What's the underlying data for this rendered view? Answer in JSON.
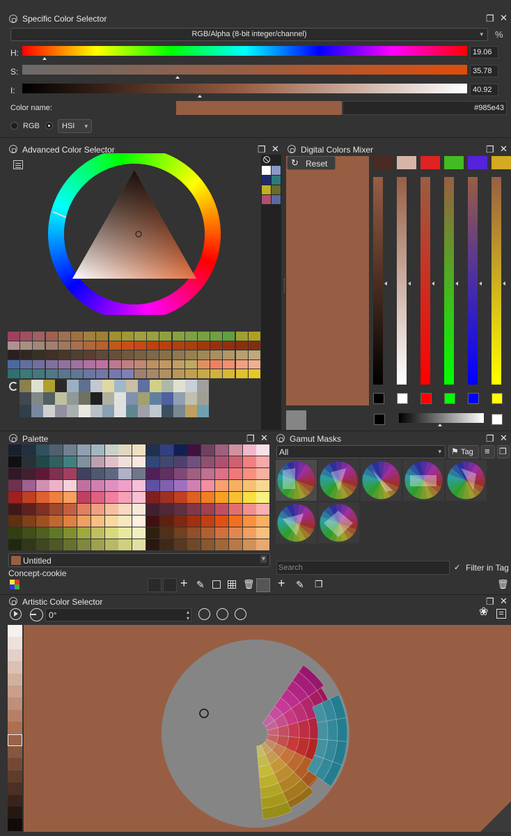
{
  "colors": {
    "current": "#985e43",
    "bg": "#333333",
    "panel": "#2b2b2b",
    "accent": "#985e43"
  },
  "specific": {
    "title": "Specific Color Selector",
    "model": "RGB/Alpha (8-bit integer/channel)",
    "percent_label": "%",
    "h_label": "H:",
    "h_value": "19.06",
    "s_label": "S:",
    "s_value": "35.78",
    "i_label": "I:",
    "i_value": "40.92",
    "h_frac": 0.0529,
    "s_frac": 0.3578,
    "i_frac": 0.4092,
    "color_name_label": "Color name:",
    "hex_value": "#985e43",
    "rgb_label": "RGB",
    "hsi_label": "HSI"
  },
  "advanced": {
    "title": "Advanced Color Selector"
  },
  "mixer": {
    "title": "Digital Colors Mixer",
    "reset_label": "Reset",
    "swatch_colors": [
      "#4a2a22",
      "#d8b4a8",
      "#e02222",
      "#44bb22",
      "#5522dd",
      "#d4aa22"
    ],
    "channel_colors": [
      "#ffffff",
      "#ff0000",
      "#00ff00",
      "#0000ff",
      "#ffff00"
    ]
  },
  "palette": {
    "title": "Palette",
    "name": "Untitled",
    "subname": "Concept-cookie"
  },
  "gamut": {
    "title": "Gamut Masks",
    "filter": "All",
    "tag_label": "Tag",
    "search_placeholder": "Search",
    "filter_in_tag": "Filter in Tag"
  },
  "artistic": {
    "title": "Artistic Color Selector",
    "angle": "0°"
  },
  "icons": [
    "lock-icon",
    "float-icon",
    "close-icon",
    "dropdown-icon",
    "reset-icon",
    "plus-icon",
    "pencil-icon",
    "save-icon",
    "grid-icon",
    "trash-icon",
    "play-icon",
    "settings-icon"
  ]
}
